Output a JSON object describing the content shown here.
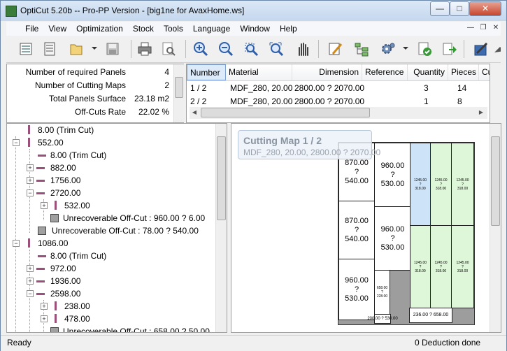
{
  "window": {
    "title": "OptiCut 5.20b -- Pro-PP Version - [big1ne for AvaxHome.ws]"
  },
  "menu": [
    "File",
    "View",
    "Optimization",
    "Stock",
    "Tools",
    "Language",
    "Window",
    "Help"
  ],
  "toolbar_icons": [
    "new-document-icon",
    "list-icon",
    "open-folder-icon",
    "save-icon",
    "print-icon",
    "print-preview-icon",
    "zoom-in-icon",
    "zoom-out-icon",
    "zoom-select-icon",
    "zoom-fit-icon",
    "pan-hand-icon",
    "edit-icon",
    "tree-icon",
    "settings-gears-icon",
    "validate-icon",
    "export-icon",
    "notes-icon"
  ],
  "stats": {
    "rows": [
      {
        "label": "Number of required Panels",
        "value": "4"
      },
      {
        "label": "Number of Cutting Maps",
        "value": "2"
      },
      {
        "label": "Total Panels Surface",
        "value": "23.18 m2"
      },
      {
        "label": "Off-Cuts Rate",
        "value": "22.02 %"
      }
    ]
  },
  "table": {
    "columns": [
      "Number",
      "Material",
      "Dimension",
      "Reference",
      "Quantity",
      "Pieces",
      "Cu"
    ],
    "rows": [
      [
        "1 / 2",
        "MDF_280, 20.00",
        "2800.00 ? 2070.00",
        "",
        "3",
        "14"
      ],
      [
        "2 / 2",
        "MDF_280, 20.00",
        "2800.00 ? 2070.00",
        "",
        "1",
        "8"
      ]
    ]
  },
  "tree": {
    "nodes": [
      {
        "text": "8.00 (Trim Cut)"
      },
      {
        "text": "552.00"
      },
      {
        "text": "8.00 (Trim Cut)"
      },
      {
        "text": "882.00"
      },
      {
        "text": "1756.00"
      },
      {
        "text": "2720.00"
      },
      {
        "text": "532.00"
      },
      {
        "text": "Unrecoverable Off-Cut : 960.00 ? 6.00"
      },
      {
        "text": "Unrecoverable Off-Cut : 78.00 ? 540.00"
      },
      {
        "text": "1086.00"
      },
      {
        "text": "8.00 (Trim Cut)"
      },
      {
        "text": "972.00"
      },
      {
        "text": "1936.00"
      },
      {
        "text": "2598.00"
      },
      {
        "text": "238.00"
      },
      {
        "text": "478.00"
      },
      {
        "text": "Unrecoverable Off-Cut : 658.00 ? 50.00"
      }
    ]
  },
  "map": {
    "title": "Cutting Map 1 / 2",
    "subtitle": "MDF_280, 20.00, 2800.00 ? 2070.00",
    "pieces": [
      {
        "text": "870.00\n?\n540.00"
      },
      {
        "text": "960.00\n?\n530.00"
      },
      {
        "text": "870.00\n?\n540.00"
      },
      {
        "text": "960.00\n?\n530.00"
      },
      {
        "text": "960.00\n?\n530.00"
      },
      {
        "text": "658.00\n?\n228.00"
      },
      {
        "text": "200.00 ? 530.00"
      },
      {
        "text": "236.00 ? 658.00"
      },
      {
        "text": "1245.00\n?\n318.00"
      },
      {
        "text": "1245.00\n?\n318.00"
      },
      {
        "text": "1245.00\n?\n318.00"
      },
      {
        "text": "1245.00\n?\n318.00"
      },
      {
        "text": "1245.00\n?\n318.00"
      },
      {
        "text": "1245.00\n?\n318.00"
      }
    ]
  },
  "status": {
    "left": "Ready",
    "right": "0 Deduction done"
  },
  "colors": {
    "trim_bar": "#9b4f7b",
    "blue_piece": "#cde3f7",
    "green_piece": "#def7d8",
    "offcut": "#9d9d9d"
  }
}
